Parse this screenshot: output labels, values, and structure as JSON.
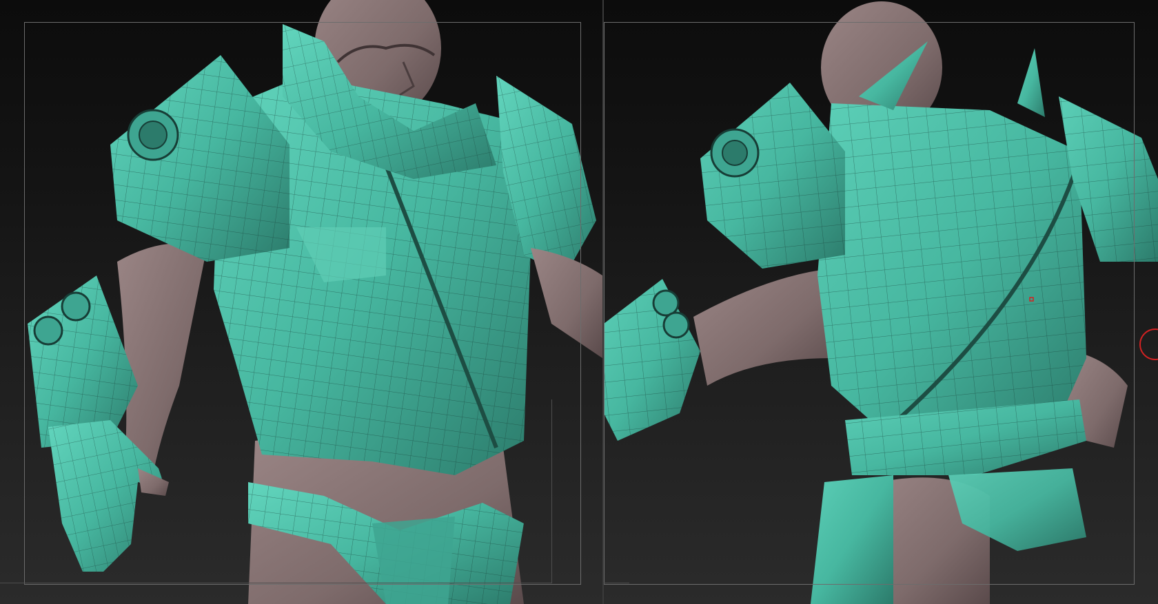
{
  "app": {
    "canvas_background_top": "#0c0c0c",
    "canvas_background_bottom": "#2b2b2b"
  },
  "viewports": [
    {
      "id": "front",
      "view": "front-three-quarter"
    },
    {
      "id": "back",
      "view": "back-three-quarter"
    }
  ],
  "colors": {
    "armor": "#47b7a0",
    "armor_highlight": "#62d5bd",
    "armor_shadow": "#2c7b6b",
    "skin": "#7e6b6b",
    "skin_shadow": "#5a4a4b",
    "wire": "#173d36",
    "brush_cursor": "#d22222",
    "frame_guide": "#6c6c6c"
  },
  "icons": {
    "brush_cursor": "brush-cursor-icon"
  }
}
